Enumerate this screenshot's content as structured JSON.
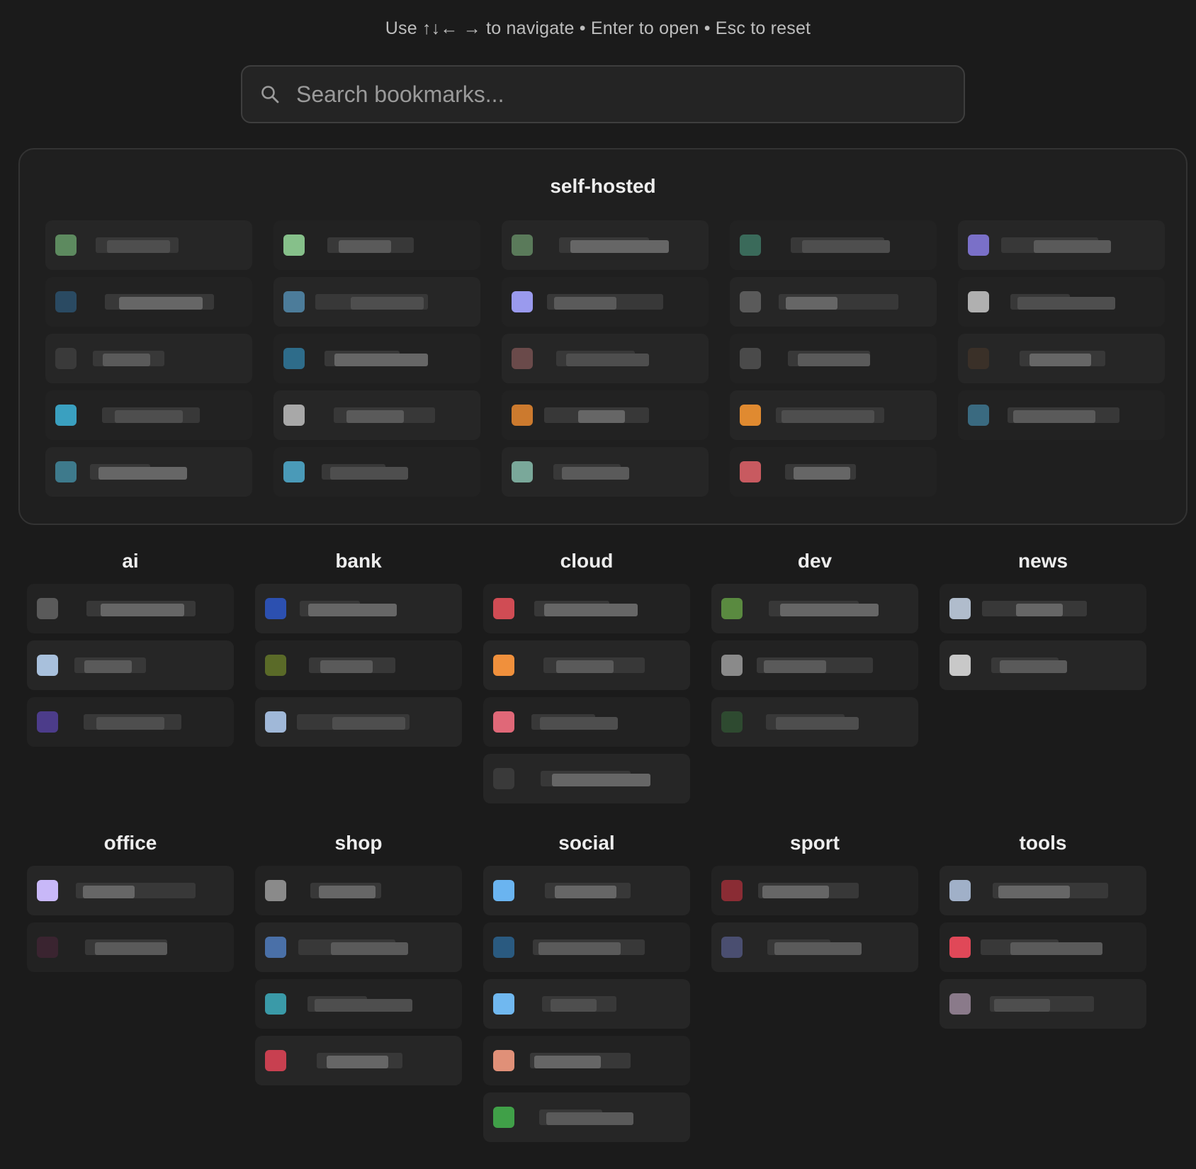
{
  "hint": "Use ↑↓← → to navigate • Enter to open • Esc to reset",
  "search": {
    "placeholder": "Search bookmarks...",
    "value": ""
  },
  "featured_group": {
    "title": "self-hosted",
    "columns": [
      {
        "favicons": [
          "#5d8a5f",
          "#2a4a62",
          "#3a3a3a",
          "#3aa0c0",
          "#3e7a8c"
        ]
      },
      {
        "favicons": [
          "#86c08a",
          "#4c7c9a",
          "#2e6c8a",
          "#a8a8a8",
          "#4a9ab8"
        ]
      },
      {
        "favicons": [
          "#5a7a5a",
          "#9a9aee",
          "#6a4a4a",
          "#cc7a2e",
          "#7aa89a"
        ]
      },
      {
        "favicons": [
          "#3a6a5a",
          "#5a5a5a",
          "#4a4a4a",
          "#e08a30",
          "#c85a60"
        ]
      },
      {
        "favicons": [
          "#7a70c8",
          "#b0b0b0",
          "#3a3028",
          "#3a6a80"
        ]
      }
    ]
  },
  "groups": [
    {
      "title": "ai",
      "favicons": [
        "#5a5a5a",
        "#a8c0dc",
        "#4c3c8a"
      ]
    },
    {
      "title": "bank",
      "favicons": [
        "#2c50b0",
        "#5a6a28",
        "#a0b8d8"
      ]
    },
    {
      "title": "cloud",
      "favicons": [
        "#d04c54",
        "#f0903c",
        "#e06878",
        "#3a3a3a"
      ]
    },
    {
      "title": "dev",
      "favicons": [
        "#5a8a40",
        "#8a8a8a",
        "#2e4a30"
      ]
    },
    {
      "title": "news",
      "favicons": [
        "#b0bccc",
        "#c8c8c8"
      ]
    },
    {
      "title": "office",
      "favicons": [
        "#c8b8f8",
        "#3a2430"
      ]
    },
    {
      "title": "shop",
      "favicons": [
        "#8a8a8a",
        "#4a70a8",
        "#3a9aa8",
        "#c84050"
      ]
    },
    {
      "title": "social",
      "favicons": [
        "#6ab4f0",
        "#2a5a80",
        "#70b8f0",
        "#e09078",
        "#40a048"
      ]
    },
    {
      "title": "sport",
      "favicons": [
        "#8a2c34",
        "#4a4e70"
      ]
    },
    {
      "title": "tools",
      "favicons": [
        "#a0b0c8",
        "#e04858",
        "#8a7a8a"
      ]
    }
  ],
  "colors": {
    "background": "#1b1b1b",
    "card": "#1f1f1f",
    "text": "#ededed"
  }
}
